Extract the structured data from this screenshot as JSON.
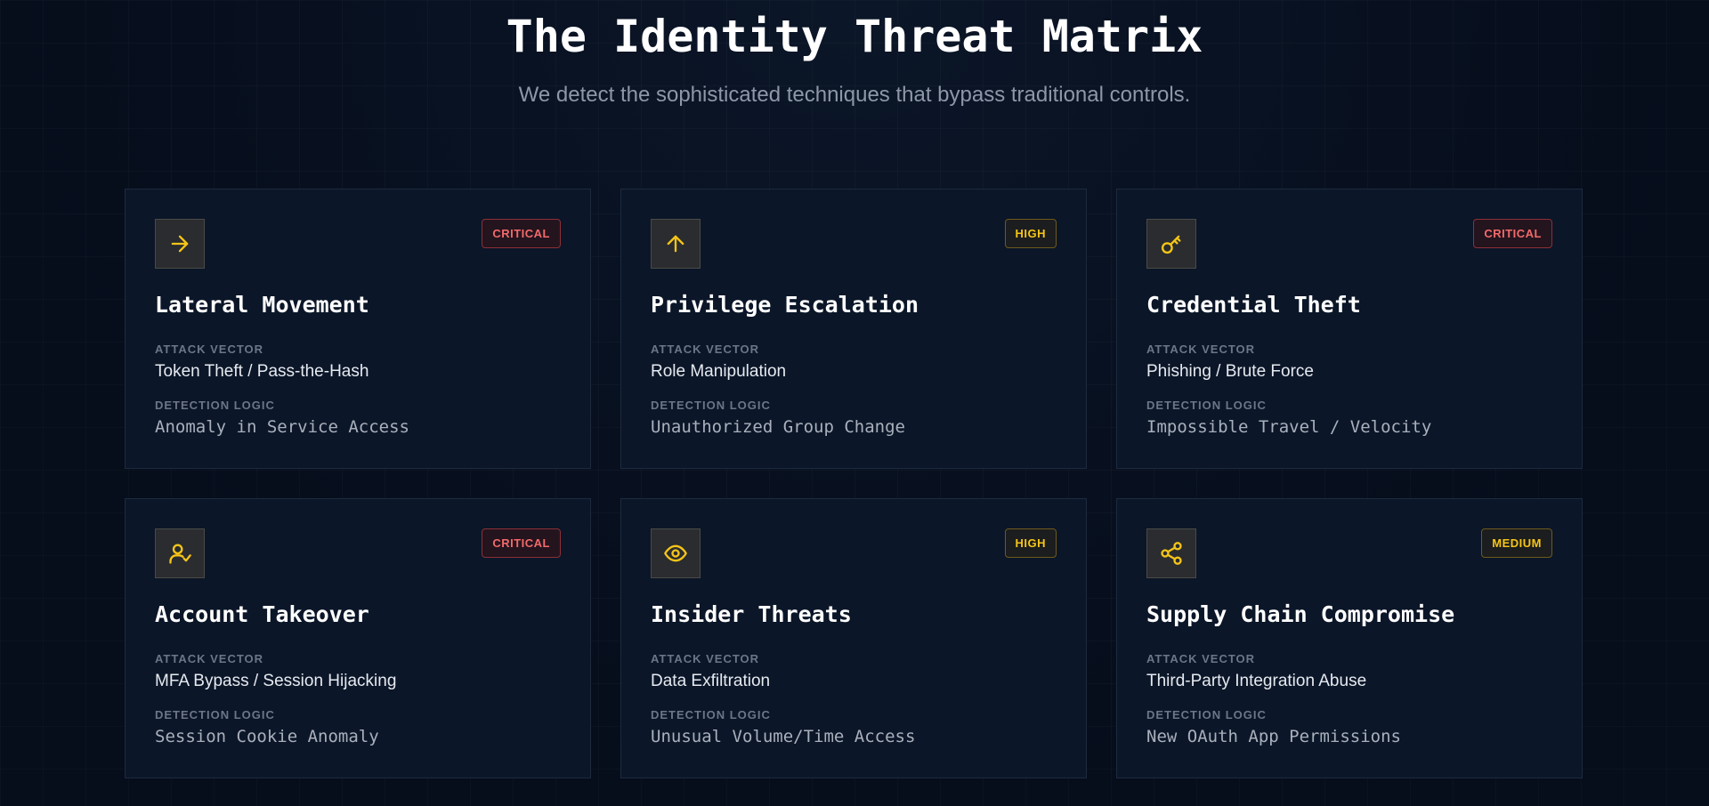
{
  "header": {
    "title": "The Identity Threat Matrix",
    "subtitle": "We detect the sophisticated techniques that bypass traditional controls."
  },
  "colors": {
    "accent": "#f5c518",
    "critical": "#f26a6a",
    "background": "#070f1f",
    "card": "#0b1628"
  },
  "threats": [
    {
      "icon": "arrow-right-icon",
      "severity": "CRITICAL",
      "title": "Lateral Movement",
      "vector_label": "ATTACK VECTOR",
      "vector": "Token Theft / Pass-the-Hash",
      "logic_label": "DETECTION LOGIC",
      "logic": "Anomaly in Service Access"
    },
    {
      "icon": "arrow-up-icon",
      "severity": "HIGH",
      "title": "Privilege Escalation",
      "vector_label": "ATTACK VECTOR",
      "vector": "Role Manipulation",
      "logic_label": "DETECTION LOGIC",
      "logic": "Unauthorized Group Change"
    },
    {
      "icon": "key-icon",
      "severity": "CRITICAL",
      "title": "Credential Theft",
      "vector_label": "ATTACK VECTOR",
      "vector": "Phishing / Brute Force",
      "logic_label": "DETECTION LOGIC",
      "logic": "Impossible Travel / Velocity"
    },
    {
      "icon": "user-check-icon",
      "severity": "CRITICAL",
      "title": "Account Takeover",
      "vector_label": "ATTACK VECTOR",
      "vector": "MFA Bypass / Session Hijacking",
      "logic_label": "DETECTION LOGIC",
      "logic": "Session Cookie Anomaly"
    },
    {
      "icon": "eye-icon",
      "severity": "HIGH",
      "title": "Insider Threats",
      "vector_label": "ATTACK VECTOR",
      "vector": "Data Exfiltration",
      "logic_label": "DETECTION LOGIC",
      "logic": "Unusual Volume/Time Access"
    },
    {
      "icon": "share-icon",
      "severity": "MEDIUM",
      "title": "Supply Chain Compromise",
      "vector_label": "ATTACK VECTOR",
      "vector": "Third-Party Integration Abuse",
      "logic_label": "DETECTION LOGIC",
      "logic": "New OAuth App Permissions"
    }
  ]
}
